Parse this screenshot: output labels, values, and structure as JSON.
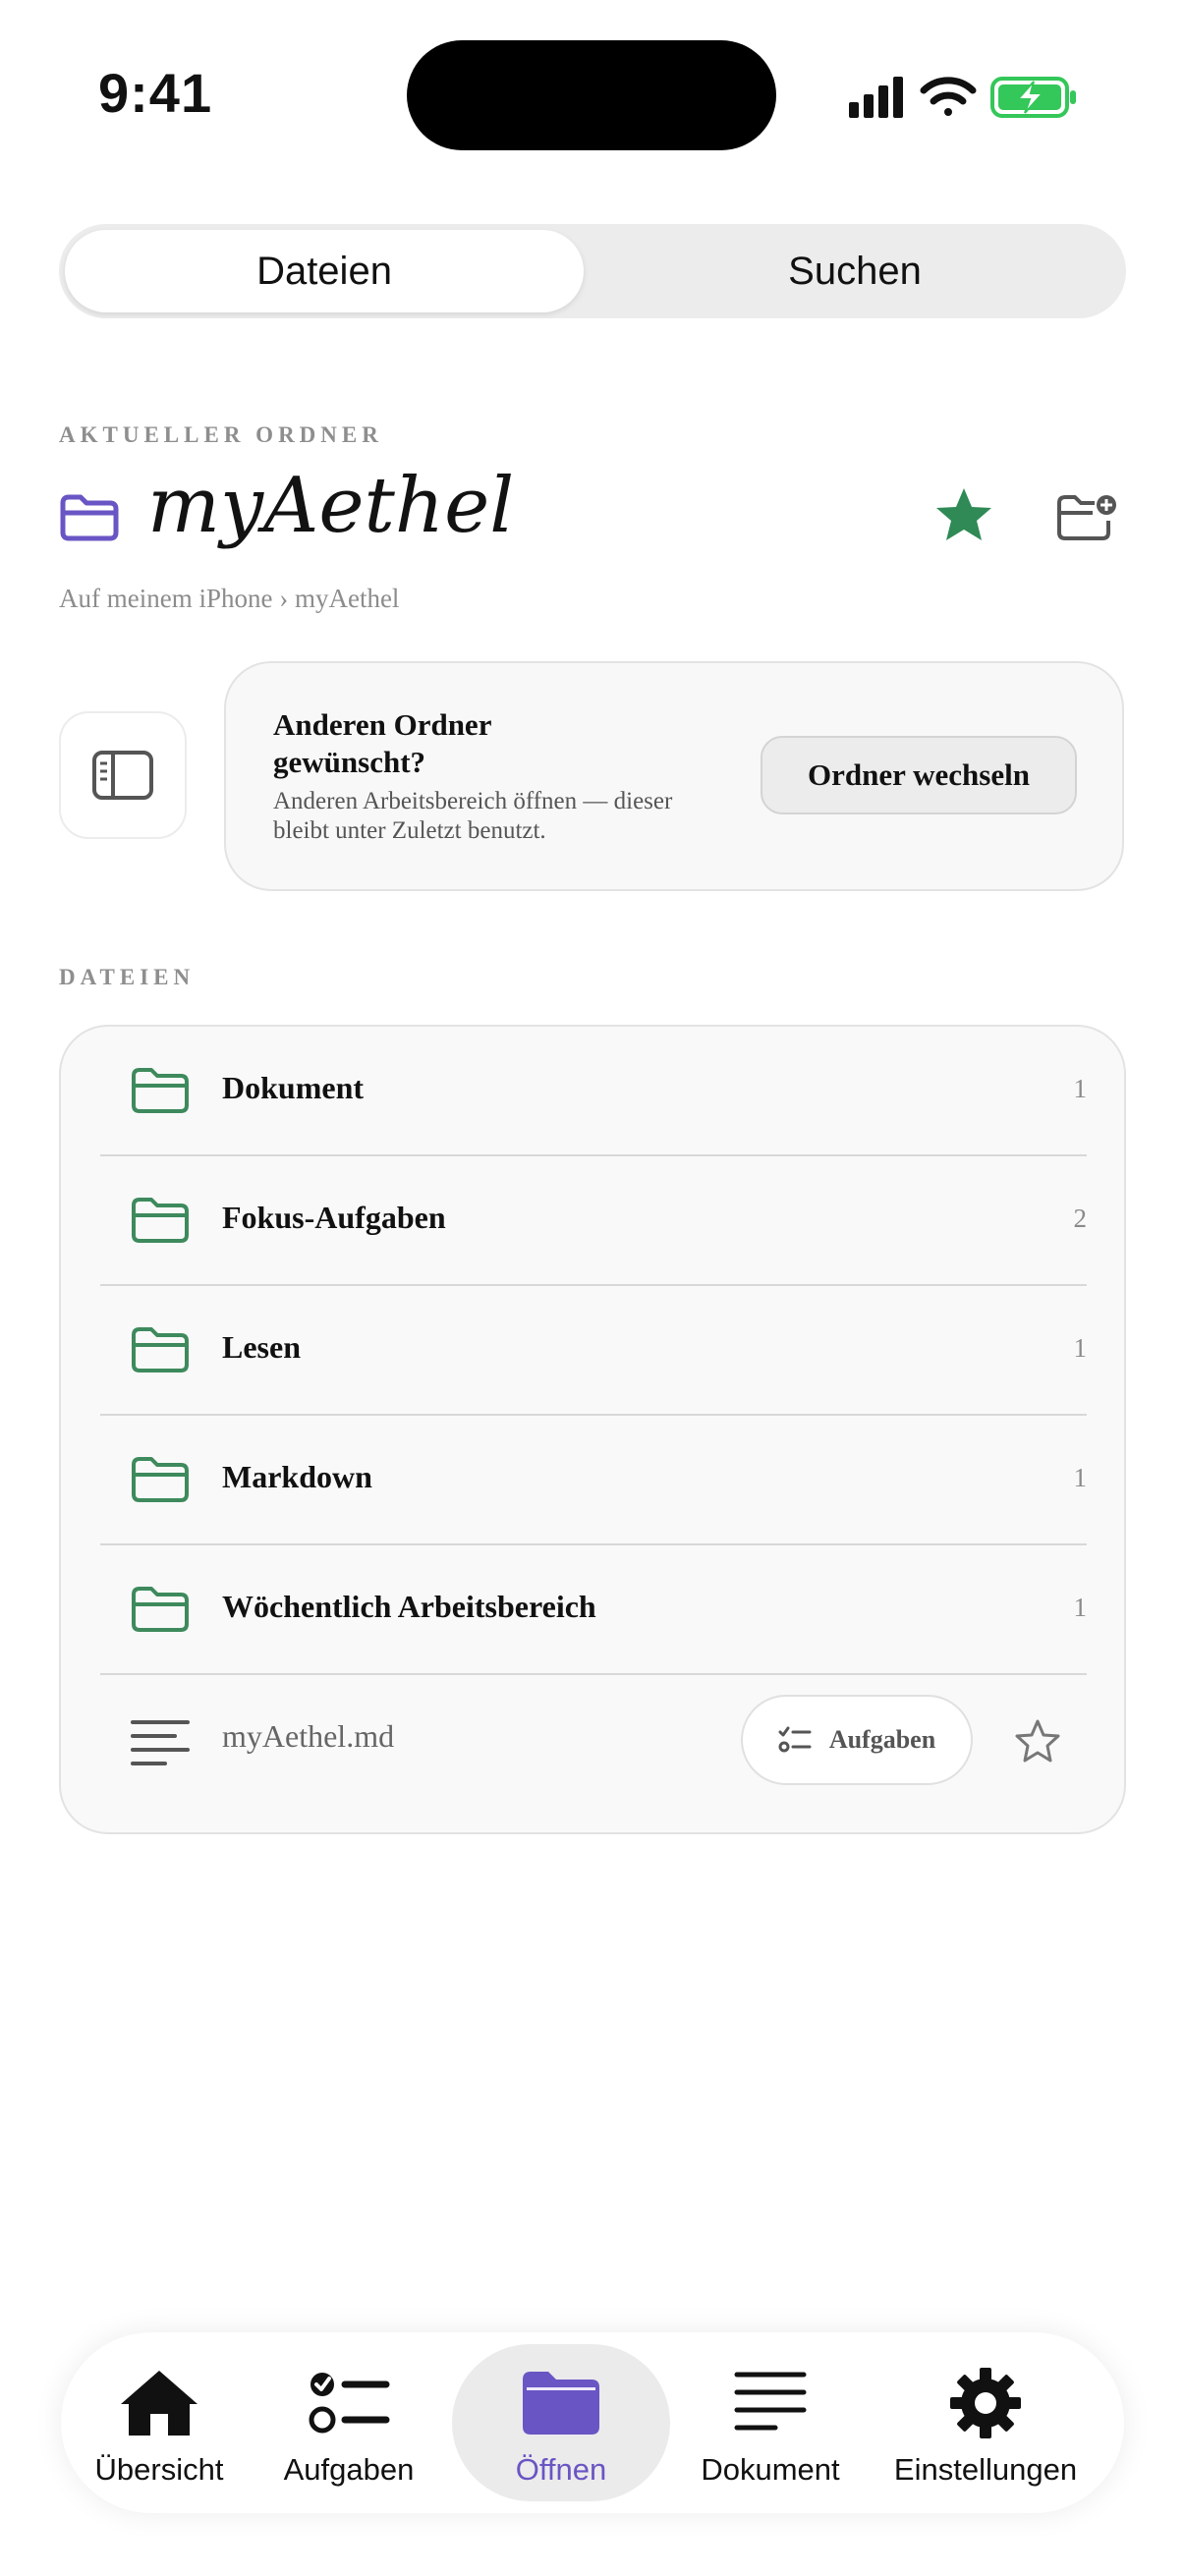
{
  "status_bar": {
    "time": "9:41"
  },
  "segmented": {
    "files": "Dateien",
    "search": "Suchen"
  },
  "current_folder": {
    "section_label": "AKTUELLER ORDNER",
    "title": "myAethel",
    "breadcrumb": "Auf meinem iPhone › myAethel"
  },
  "switch_card": {
    "title": "Anderen Ordner gewünscht?",
    "description": "Anderen Arbeitsbereich öffnen — dieser bleibt unter Zuletzt benutzt.",
    "button": "Ordner wechseln"
  },
  "files": {
    "section_label": "DATEIEN",
    "folders": [
      {
        "name": "Dokument",
        "count": "1"
      },
      {
        "name": "Fokus-Aufgaben",
        "count": "2"
      },
      {
        "name": "Lesen",
        "count": "1"
      },
      {
        "name": "Markdown",
        "count": "1"
      },
      {
        "name": "Wöchentlich Arbeitsbereich",
        "count": "1"
      }
    ],
    "file": {
      "name": "myAethel.md",
      "tasks_label": "Aufgaben"
    }
  },
  "tabbar": {
    "items": [
      {
        "label": "Übersicht",
        "icon": "house-icon"
      },
      {
        "label": "Aufgaben",
        "icon": "checklist-icon"
      },
      {
        "label": "Öffnen",
        "icon": "folder-icon",
        "active": true
      },
      {
        "label": "Dokument",
        "icon": "text-lines-icon"
      },
      {
        "label": "Einstellungen",
        "icon": "gear-icon"
      }
    ]
  },
  "colors": {
    "accent_purple": "#6a55c4",
    "folder_green": "#3e8a5d",
    "star_green": "#2f8a55",
    "battery_green": "#34c759"
  }
}
